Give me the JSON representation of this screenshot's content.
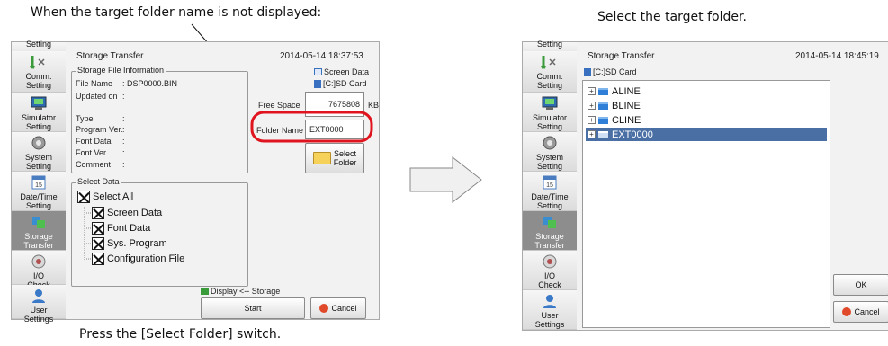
{
  "captions": {
    "left_top": "When the target folder name is not displayed:",
    "left_bottom": "Press the [Select Folder] switch.",
    "right_top": "Select the target folder."
  },
  "sidebar": {
    "top_partial": "Setting",
    "items": [
      {
        "label": "Comm.\nSetting",
        "icon": "comm-icon"
      },
      {
        "label": "Simulator\nSetting",
        "icon": "simulator-icon"
      },
      {
        "label": "System\nSetting",
        "icon": "system-icon"
      },
      {
        "label": "Date/Time\nSetting",
        "icon": "calendar-icon"
      },
      {
        "label": "Storage\nTransfer",
        "icon": "storage-icon"
      },
      {
        "label": "I/O\nCheck",
        "icon": "io-icon"
      },
      {
        "label": "User\nSettings",
        "icon": "user-icon"
      }
    ]
  },
  "left": {
    "title": "Storage Transfer",
    "datetime": "2014-05-14 18:37:53",
    "info_group": "Storage File Information",
    "file_name_label": "File Name",
    "file_name_value": ": DSP0000.BIN",
    "updated_label": "Updated on",
    "updated_value": ":",
    "type_label": "Type",
    "program_label": "Program Ver.",
    "font_label": "Font Data",
    "fontver_label": "Font Ver.",
    "comment_label": "Comment",
    "colon": ":",
    "screen_data": "Screen Data",
    "sd_card": "[C:]SD Card",
    "free_space_label": "Free Space",
    "free_space_value": "7675808",
    "free_space_unit": "KB",
    "folder_name_label": "Folder Name",
    "folder_name_value": "EXT0000",
    "select_folder_line1": "Select",
    "select_folder_line2": "Folder",
    "select_data_group": "Select Data",
    "checks": [
      "Select All",
      "Screen Data",
      "Font Data",
      "Sys. Program",
      "Configuration File"
    ],
    "direction": "Display <-- Storage",
    "start": "Start",
    "cancel": "Cancel"
  },
  "right": {
    "title": "Storage Transfer",
    "datetime": "2014-05-14 18:45:19",
    "sd_card": "[C:]SD Card",
    "folders": [
      "ALINE",
      "BLINE",
      "CLINE",
      "EXT0000"
    ],
    "selected_index": 3,
    "ok": "OK",
    "cancel": "Cancel"
  },
  "colors": {
    "highlight_ring": "#e0141e",
    "selection": "#4a6fa5",
    "cancel_icon": "#e04a2a"
  }
}
